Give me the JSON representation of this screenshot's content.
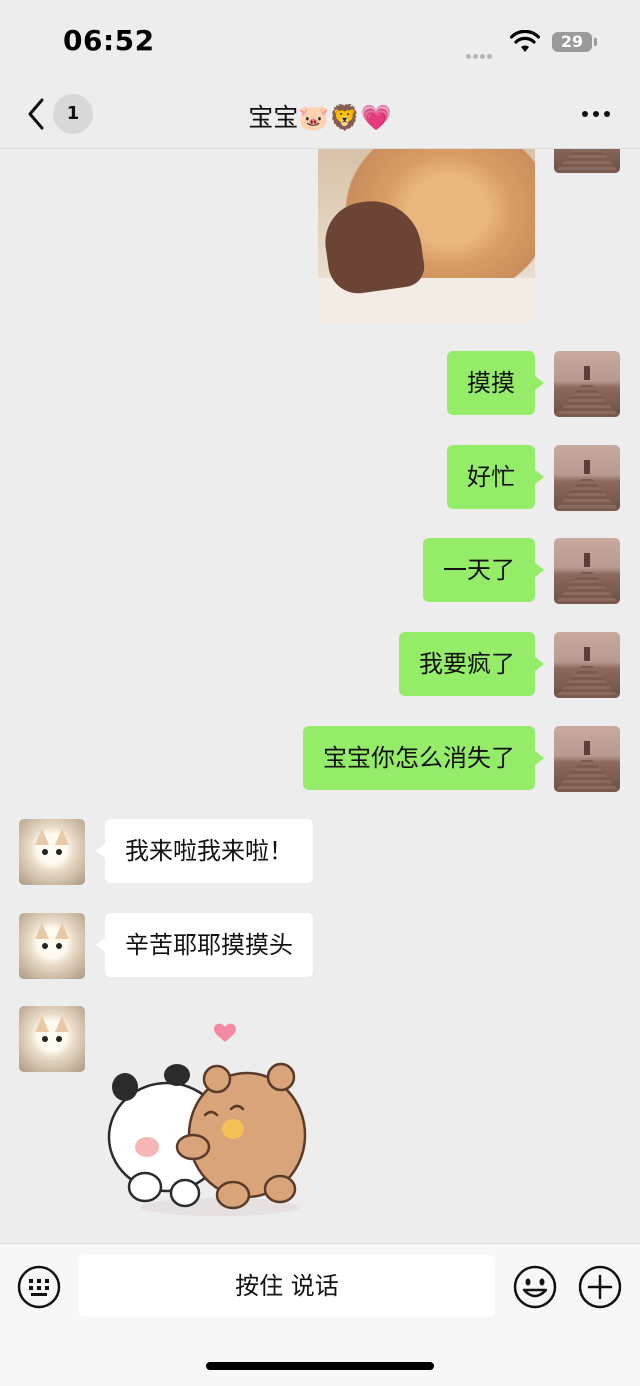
{
  "status_bar": {
    "time": "06:52",
    "battery_level": "29"
  },
  "nav": {
    "unread_count": "1",
    "title": "宝宝🐷🦁💗"
  },
  "messages": [
    {
      "type": "image",
      "direction": "out",
      "description_icon": "cat-photo"
    },
    {
      "type": "text",
      "direction": "out",
      "text": "摸摸"
    },
    {
      "type": "text",
      "direction": "out",
      "text": "好忙"
    },
    {
      "type": "text",
      "direction": "out",
      "text": "一天了"
    },
    {
      "type": "text",
      "direction": "out",
      "text": "我要疯了"
    },
    {
      "type": "text",
      "direction": "out",
      "text": "宝宝你怎么消失了"
    },
    {
      "type": "text",
      "direction": "in",
      "text": "我来啦我来啦！"
    },
    {
      "type": "text",
      "direction": "in",
      "text": "辛苦耶耶摸摸头"
    },
    {
      "type": "sticker",
      "direction": "in",
      "description_icon": "hugging-bears-sticker"
    }
  ],
  "input_bar": {
    "hold_to_talk_label": "按住 说话"
  },
  "colors": {
    "outgoing_bubble": "#95ec69",
    "incoming_bubble": "#ffffff",
    "background": "#ededed"
  }
}
